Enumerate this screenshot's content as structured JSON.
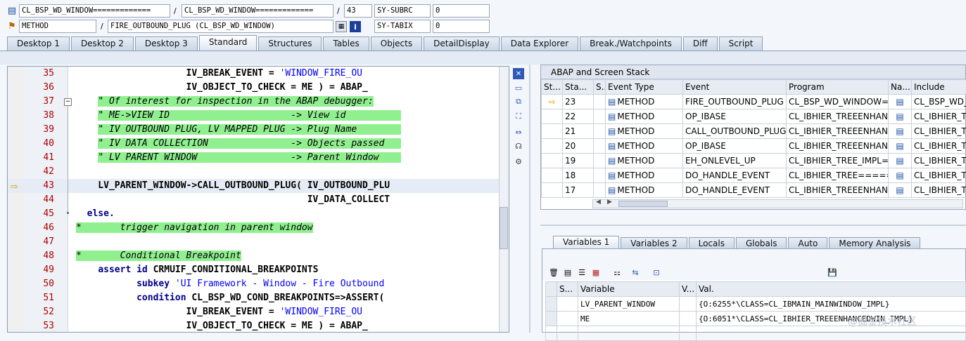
{
  "header": {
    "row1": {
      "field1": "CL_BSP_WD_WINDOW=============",
      "field2": "CL_BSP_WD_WINDOW=============",
      "field3": "43",
      "sy_label": "SY-SUBRC",
      "sy_value": "0"
    },
    "row2": {
      "field1": "METHOD",
      "field2": "FIRE_OUTBOUND_PLUG (CL_BSP_WD_WINDOW)",
      "sy_label": "SY-TABIX",
      "sy_value": "0"
    },
    "slash": "/"
  },
  "tabs": [
    "Desktop 1",
    "Desktop 2",
    "Desktop 3",
    "Standard",
    "Structures",
    "Tables",
    "Objects",
    "DetailDisplay",
    "Data Explorer",
    "Break./Watchpoints",
    "Diff",
    "Script"
  ],
  "active_tab": "Standard",
  "code_lines": [
    {
      "n": "35",
      "parts": [
        {
          "t": "                    IV_BREAK_EVENT = ",
          "c": "b"
        },
        {
          "t": "'WINDOW_FIRE_OU",
          "c": "str"
        }
      ]
    },
    {
      "n": "36",
      "parts": [
        {
          "t": "                    IV_OBJECT_TO_CHECK = ME ) = ABAP_",
          "c": "b"
        }
      ]
    },
    {
      "n": "37",
      "parts": [
        {
          "t": "    ",
          "c": ""
        },
        {
          "t": "\" Of interest for inspection in the ABAP debugger:",
          "c": "cmt"
        }
      ]
    },
    {
      "n": "38",
      "parts": [
        {
          "t": "    ",
          "c": ""
        },
        {
          "t": "\" ME->VIEW ID                      -> View id          ",
          "c": "cmt"
        }
      ]
    },
    {
      "n": "39",
      "parts": [
        {
          "t": "    ",
          "c": ""
        },
        {
          "t": "\" IV OUTBOUND PLUG, LV MAPPED PLUG -> Plug Name        ",
          "c": "cmt"
        }
      ]
    },
    {
      "n": "40",
      "parts": [
        {
          "t": "    ",
          "c": ""
        },
        {
          "t": "\" IV DATA COLLECTION               -> Objects passed   ",
          "c": "cmt"
        }
      ]
    },
    {
      "n": "41",
      "parts": [
        {
          "t": "    ",
          "c": ""
        },
        {
          "t": "\" LV PARENT WINDOW                 -> Parent Window    ",
          "c": "cmt"
        }
      ]
    },
    {
      "n": "42",
      "parts": [
        {
          "t": "",
          "c": ""
        }
      ]
    },
    {
      "n": "43",
      "parts": [
        {
          "t": "    LV_PARENT_WINDOW->CALL_OUTBOUND_PLUG( IV_OUTBOUND_PLU",
          "c": "b"
        }
      ]
    },
    {
      "n": "44",
      "parts": [
        {
          "t": "                                          IV_DATA_COLLECT",
          "c": "b"
        }
      ]
    },
    {
      "n": "45",
      "parts": [
        {
          "t": "  else.",
          "c": "b kw"
        }
      ]
    },
    {
      "n": "46",
      "parts": [
        {
          "t": "*       trigger navigation in parent window",
          "c": "cmt"
        }
      ]
    },
    {
      "n": "47",
      "parts": [
        {
          "t": "",
          "c": ""
        }
      ]
    },
    {
      "n": "48",
      "parts": [
        {
          "t": "*       Conditional Breakpoint",
          "c": "cmt"
        }
      ]
    },
    {
      "n": "49",
      "parts": [
        {
          "t": "    ",
          "c": ""
        },
        {
          "t": "assert id ",
          "c": "b kw"
        },
        {
          "t": "CRMUIF_CONDITIONAL_BREAKPOINTS",
          "c": "b"
        }
      ]
    },
    {
      "n": "50",
      "parts": [
        {
          "t": "           ",
          "c": ""
        },
        {
          "t": "subkey ",
          "c": "b kw"
        },
        {
          "t": "'UI Framework - Window - Fire Outbound",
          "c": "str"
        }
      ]
    },
    {
      "n": "51",
      "parts": [
        {
          "t": "           ",
          "c": ""
        },
        {
          "t": "condition ",
          "c": "b kw"
        },
        {
          "t": "CL_BSP_WD_COND_BREAKPOINTS=>ASSERT(",
          "c": "b"
        }
      ]
    },
    {
      "n": "52",
      "parts": [
        {
          "t": "                    IV_BREAK_EVENT = ",
          "c": "b"
        },
        {
          "t": "'WINDOW_FIRE_OU",
          "c": "str"
        }
      ]
    },
    {
      "n": "53",
      "parts": [
        {
          "t": "                    IV_OBJECT_TO_CHECK = ME ) = ABAP_",
          "c": "b"
        }
      ]
    }
  ],
  "stack": {
    "title": "ABAP and Screen Stack",
    "columns": [
      "St...",
      "Sta...",
      "S...",
      "Event Type",
      "Event",
      "Program",
      "Na...",
      "Include"
    ],
    "rows": [
      {
        "level": "23",
        "type": "METHOD",
        "event": "FIRE_OUTBOUND_PLUG",
        "program": "CL_BSP_WD_WINDOW=...",
        "include": "CL_BSP_WD_W"
      },
      {
        "level": "22",
        "type": "METHOD",
        "event": "OP_IBASE",
        "program": "CL_IBHIER_TREEENHAN...",
        "include": "CL_IBHIER_TR"
      },
      {
        "level": "21",
        "type": "METHOD",
        "event": "CALL_OUTBOUND_PLUG",
        "program": "CL_IBHIER_TREEENHAN...",
        "include": "CL_IBHIER_TR"
      },
      {
        "level": "20",
        "type": "METHOD",
        "event": "OP_IBASE",
        "program": "CL_IBHIER_TREEENHAN...",
        "include": "CL_IBHIER_TR"
      },
      {
        "level": "19",
        "type": "METHOD",
        "event": "EH_ONLEVEL_UP",
        "program": "CL_IBHIER_TREE_IMPL=...",
        "include": "CL_IBHIER_TR"
      },
      {
        "level": "18",
        "type": "METHOD",
        "event": "DO_HANDLE_EVENT",
        "program": "CL_IBHIER_TREE=====...",
        "include": "CL_IBHIER_TR"
      },
      {
        "level": "17",
        "type": "METHOD",
        "event": "DO_HANDLE_EVENT",
        "program": "CL_IBHIER_TREEENHAN...",
        "include": "CL_IBHIER_TR"
      }
    ]
  },
  "var_tabs": [
    "Variables 1",
    "Variables 2",
    "Locals",
    "Globals",
    "Auto",
    "Memory Analysis"
  ],
  "vars": {
    "columns": [
      "S...",
      "Variable",
      "V...",
      "Val."
    ],
    "rows": [
      {
        "name": "LV_PARENT_WINDOW",
        "value": "{O:6255*\\CLASS=CL_IBMAIN_MAINWINDOW_IMPL}"
      },
      {
        "name": "ME",
        "value": "{O:6051*\\CLASS=CL_IBHIER_TREEENHANCEDWIN_IMPL}"
      }
    ]
  },
  "colors": {
    "comment_bg": "#90f090",
    "line_number": "#b00000",
    "keyword": "#00008b",
    "string": "#0000ff"
  }
}
